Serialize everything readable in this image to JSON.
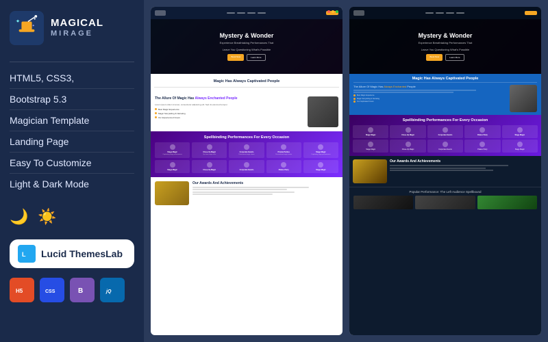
{
  "left": {
    "logo_name": "MAGICAL",
    "logo_sub": "MIRAGE",
    "features": [
      "HTML5, CSS3,",
      "Bootstrap 5.3",
      "Magician Template",
      "Landing Page",
      "Easy To Customize",
      "Light & Dark Mode"
    ],
    "lucid_label": "Lucid ThemesLab",
    "badges": [
      "H5",
      "CSS",
      "B",
      "jQ"
    ],
    "badge_titles": [
      "HTML5",
      "CSS3",
      "Bootstrap",
      "jQuery"
    ]
  },
  "preview1": {
    "nav_btn": "Book Now",
    "hero_title": "Mystery & Wonder",
    "hero_sub": "Experience Breathtaking Performances That",
    "hero_sub2": "Leave You Questioning What's Possible",
    "btn1": "Book Now",
    "btn2": "Learn More",
    "about_section_title": "Magic Has Always Captivated People",
    "about_section_subtitle": "The Allure Of Magic Has",
    "about_section_subtitle2": "Always Enchanted People",
    "features": [
      "Best Magic Experience",
      "Magic Storytelling & Narrating",
      "Our Experienced Crews"
    ],
    "services_title": "Spellbinding Performances For Every Occasion",
    "services": [
      {
        "name": "Stage Magic",
        "desc": "Captivating stage performances"
      },
      {
        "name": "Close-Up Magic",
        "desc": "Up close magic tricks"
      },
      {
        "name": "Corporate Events",
        "desc": "Professional magic shows"
      },
      {
        "name": "Private Parties",
        "desc": "Personalized magic events"
      },
      {
        "name": "Stage Magic",
        "desc": "Captivating stage performances"
      }
    ],
    "awards_title": "Our Awards And Achievements"
  },
  "preview2": {
    "hero_title": "Mystery & Wonder",
    "hero_sub": "Experience Breathtaking Performances That",
    "hero_sub2": "Leave You Questioning What's Possible",
    "about_title": "Magic Has Always Captivated People",
    "about_sub": "The Allure Of Magic Has Always Enchanted People",
    "services_title": "Spellbinding Performances For Every Occasion",
    "services": [
      {
        "name": "Stage Magic"
      },
      {
        "name": "Close-Up Magic"
      },
      {
        "name": "Corporate Events"
      },
      {
        "name": "Palace Party"
      },
      {
        "name": "Stage Magic"
      }
    ],
    "awards_title": "Our Awards And Achievements",
    "popular_title": "Popular Performance: The Left Audience Spellbound"
  }
}
